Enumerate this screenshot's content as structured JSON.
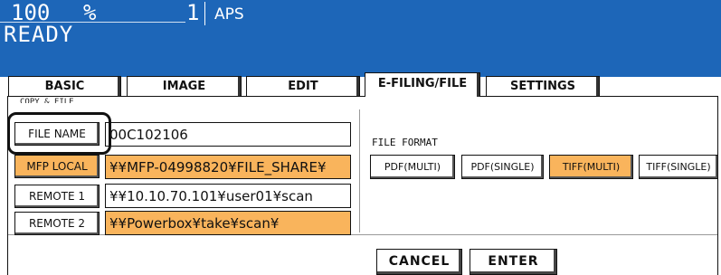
{
  "status": {
    "zoom": "100",
    "zoom_unit": "%",
    "copies": "1",
    "paper": "APS",
    "message": "READY"
  },
  "tabs": [
    {
      "label": "BASIC",
      "active": false
    },
    {
      "label": "IMAGE",
      "active": false
    },
    {
      "label": "EDIT",
      "active": false
    },
    {
      "label": "E-FILING/FILE",
      "active": true
    },
    {
      "label": "SETTINGS",
      "active": false
    }
  ],
  "copy_file": {
    "group_label": "COPY & FILE",
    "file_name_button": "FILE NAME",
    "file_name_value": "00C102106",
    "mfp_local_button": "MFP LOCAL",
    "mfp_local_value": "¥¥MFP-04998820¥FILE_SHARE¥",
    "remote1_button": "REMOTE 1",
    "remote1_value": "¥¥10.10.70.101¥user01¥scan",
    "remote2_button": "REMOTE 2",
    "remote2_value": "¥¥Powerbox¥take¥scan¥"
  },
  "file_format": {
    "title": "FILE FORMAT",
    "options": [
      {
        "label": "PDF(MULTI)",
        "selected": false
      },
      {
        "label": "PDF(SINGLE)",
        "selected": false
      },
      {
        "label": "TIFF(MULTI)",
        "selected": true
      },
      {
        "label": "TIFF(SINGLE)",
        "selected": false
      }
    ]
  },
  "actions": {
    "cancel": "CANCEL",
    "enter": "ENTER"
  },
  "colors": {
    "status_bg": "#1d66b8",
    "highlight": "#f9b45c"
  }
}
